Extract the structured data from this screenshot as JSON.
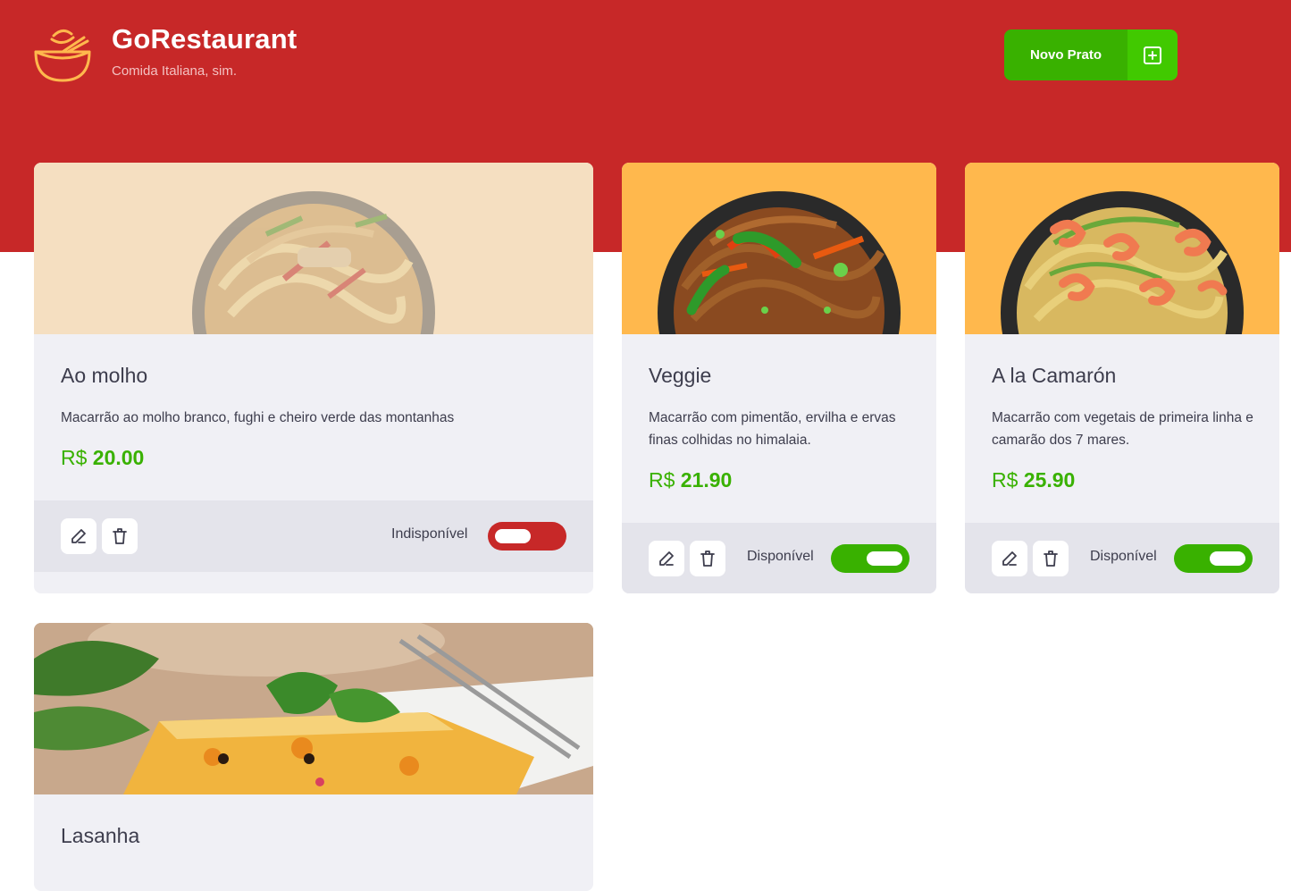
{
  "header": {
    "title": "GoRestaurant",
    "subtitle": "Comida Italiana, sim.",
    "new_button_label": "Novo Prato",
    "logo_icon": "bowl-icon",
    "new_button_icon": "plus-square-icon"
  },
  "colors": {
    "header": "#c72828",
    "accent_green": "#39b100",
    "accent_green_light": "#41c900",
    "card_bg": "#f0f0f5",
    "footer_bg": "#e4e4eb",
    "toggle_off": "#c72828",
    "unavailable_img_bg": "#f5dfc1",
    "available_img_bg": "#ffb84d"
  },
  "dishes": [
    {
      "name": "Ao molho",
      "description": "Macarrão ao molho branco, fughi e cheiro verde das montanhas",
      "currency": "R$",
      "price": "20.00",
      "available": false,
      "status_label": "Indisponível",
      "edit_icon": "pencil-icon",
      "delete_icon": "trash-icon"
    },
    {
      "name": "Veggie",
      "description": "Macarrão com pimentão, ervilha e ervas finas colhidas no himalaia.",
      "currency": "R$",
      "price": "21.90",
      "available": true,
      "status_label": "Disponível",
      "edit_icon": "pencil-icon",
      "delete_icon": "trash-icon"
    },
    {
      "name": "A la Camarón",
      "description": "Macarrão com vegetais de primeira linha e camarão dos 7 mares.",
      "currency": "R$",
      "price": "25.90",
      "available": true,
      "status_label": "Disponível",
      "edit_icon": "pencil-icon",
      "delete_icon": "trash-icon"
    },
    {
      "name": "Lasanha"
    }
  ]
}
